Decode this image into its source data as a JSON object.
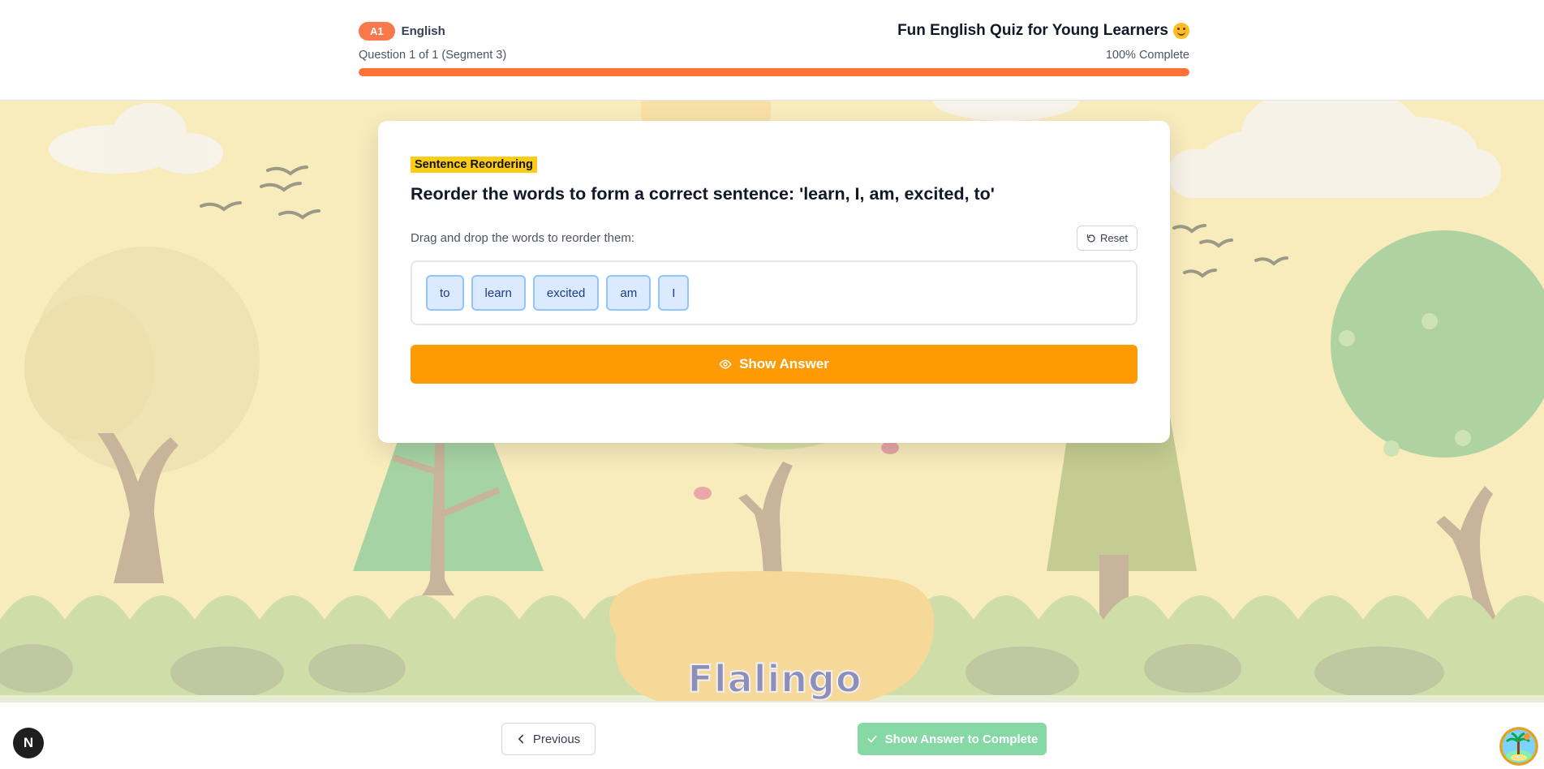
{
  "header": {
    "level": "A1",
    "language": "English",
    "quiz_title": "Fun English Quiz for Young Learners",
    "title_emoji": "smiling-face-icon",
    "question_progress": "Question 1 of 1 (Segment 3)",
    "percent_text": "100% Complete",
    "progress_fraction": 1.0,
    "accent_color": "#fe7235"
  },
  "card": {
    "question_type": "Sentence Reordering",
    "question": "Reorder the words to form a correct sentence: 'learn, I, am, excited, to'",
    "instruction": "Drag and drop the words to reorder them:",
    "reset_label": "Reset",
    "words": [
      "to",
      "learn",
      "excited",
      "am",
      "I"
    ],
    "show_answer_label": "Show Answer"
  },
  "background": {
    "logo_text": "Flalingo Kids"
  },
  "footer": {
    "previous_label": "Previous",
    "complete_label": "Show Answer to Complete",
    "dev_badge": "N"
  },
  "colors": {
    "primary_orange": "#fe9a04",
    "chip_bg": "#dbeafe",
    "chip_border": "#93c5fd",
    "complete_green": "#86d9a5",
    "tag_yellow": "#facc15"
  }
}
